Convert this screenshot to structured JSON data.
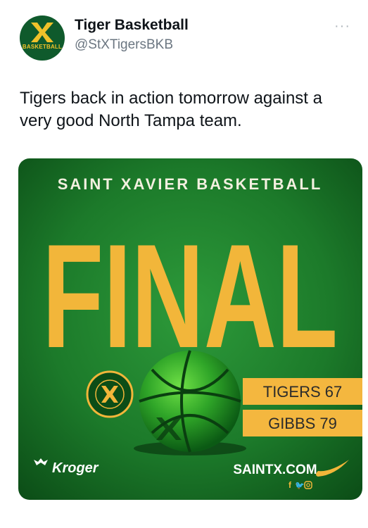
{
  "account": {
    "name": "Tiger Basketball",
    "handle": "@StXTigersBKB",
    "avatar_text": "BASKETBALL"
  },
  "more_label": "···",
  "tweet": {
    "text": "Tigers back in action tomorrow against a very good North Tampa team."
  },
  "graphic": {
    "top_title": "SAINT XAVIER BASKETBALL",
    "headline": "FINAL",
    "badge_text": "SAINT XAVIER BASKETBALL",
    "scores": [
      {
        "label": "TIGERS 67"
      },
      {
        "label": "GIBBS 79"
      }
    ],
    "sponsor": "Kroger",
    "website": "SAINTX.COM",
    "social_icons": [
      "facebook-icon",
      "twitter-icon",
      "instagram-icon"
    ],
    "colors": {
      "green_dark": "#0c4d17",
      "green_mid": "#1f8a2e",
      "gold": "#f2b63a",
      "score_box": "#f4b73f",
      "score_text": "#2b2b2b"
    }
  }
}
